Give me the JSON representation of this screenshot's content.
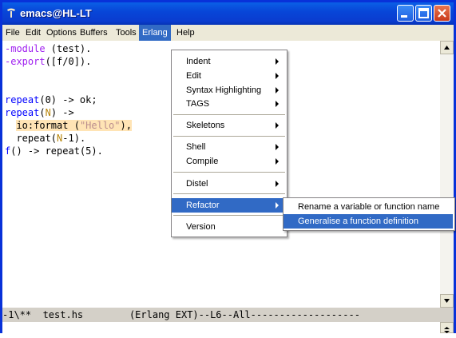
{
  "window": {
    "title": "emacs@HL-LT"
  },
  "menubar": {
    "items": [
      "File",
      "Edit",
      "Options",
      "Buffers",
      "Tools",
      "Erlang",
      "Help"
    ],
    "active": "Erlang"
  },
  "code": {
    "line1_a": "-module",
    "line1_b": " (test).",
    "line2_a": "-export",
    "line2_b": "([f/0]).",
    "line4_a": "repeat",
    "line4_b": "(0) -> ok;",
    "line5_a": "repeat",
    "line5_b": "(",
    "line5_c": "N",
    "line5_d": ") ->",
    "line6_a": "io:format",
    "line6_b": " (",
    "line6_c": "\"Hello\"",
    "line6_d": "),",
    "line7_a": "  repeat(",
    "line7_b": "N",
    "line7_c": "-1).",
    "line8_a": "f",
    "line8_b": "() -> repeat(5)."
  },
  "modeline": "-1\\**  test.hs        (Erlang EXT)--L6--All-------------------",
  "erlang_menu": {
    "items": [
      "Indent",
      "Edit",
      "Syntax Highlighting",
      "TAGS",
      "Skeletons",
      "Shell",
      "Compile",
      "Distel",
      "Refactor",
      "Version"
    ],
    "selected": "Refactor"
  },
  "refactor_menu": {
    "items": [
      "Rename a variable or function name",
      "Generalise a function definition"
    ],
    "selected": "Generalise a function definition"
  },
  "colors": {
    "accent": "#316ac5",
    "titlebar": "#0a3ccf",
    "keyword": "#a020f0",
    "function": "#0000ff",
    "variable": "#b8860b",
    "string": "#bc8f8f",
    "highlight": "#ffe4b5"
  }
}
